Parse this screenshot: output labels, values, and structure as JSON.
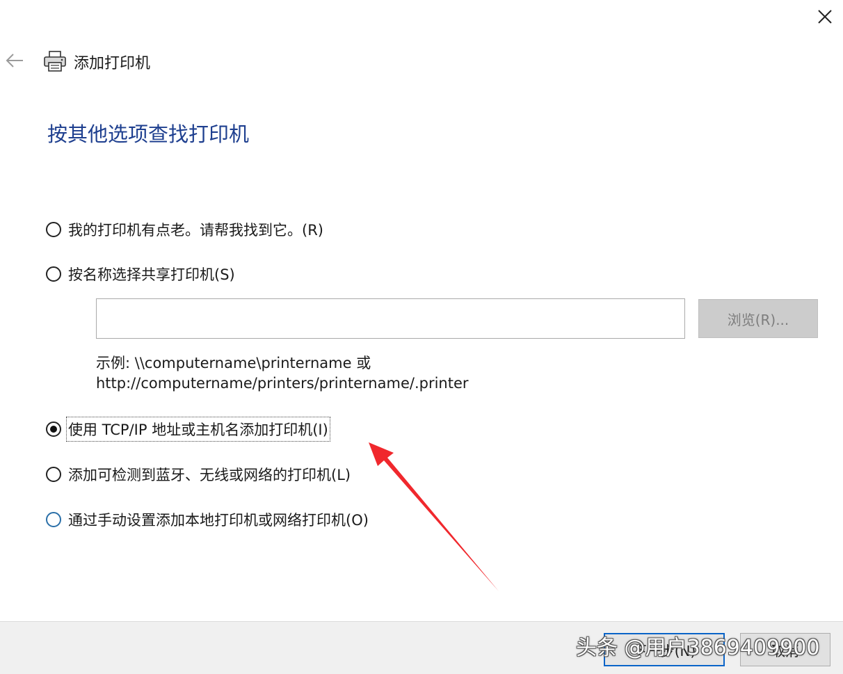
{
  "window": {
    "title": "添加打印机",
    "close_glyph": "✕",
    "back_glyph": "←"
  },
  "heading": "按其他选项查找打印机",
  "options": [
    {
      "label": "我的打印机有点老。请帮我找到它。(R)",
      "selected": false
    },
    {
      "label": "按名称选择共享打印机(S)",
      "selected": false
    },
    {
      "label": "使用 TCP/IP 地址或主机名添加打印机(I)",
      "selected": true
    },
    {
      "label": "添加可检测到蓝牙、无线或网络的打印机(L)",
      "selected": false
    },
    {
      "label": "通过手动设置添加本地打印机或网络打印机(O)",
      "selected": false
    }
  ],
  "shared_printer": {
    "input_value": "",
    "browse_label": "浏览(R)...",
    "example_line1": "示例: \\\\computername\\printername 或",
    "example_line2": "http://computername/printers/printername/.printer"
  },
  "footer": {
    "next_label": "下一步(N)",
    "cancel_label": "取消"
  },
  "watermark": "头条 @用户3869409900",
  "colors": {
    "heading": "#1e3f8f",
    "arrow": "#f0282d",
    "focus_border": "#0a64c8"
  },
  "icons": {
    "close": "close-icon",
    "back": "back-arrow-icon",
    "printer": "printer-icon",
    "annotation": "red-arrow-annotation"
  }
}
